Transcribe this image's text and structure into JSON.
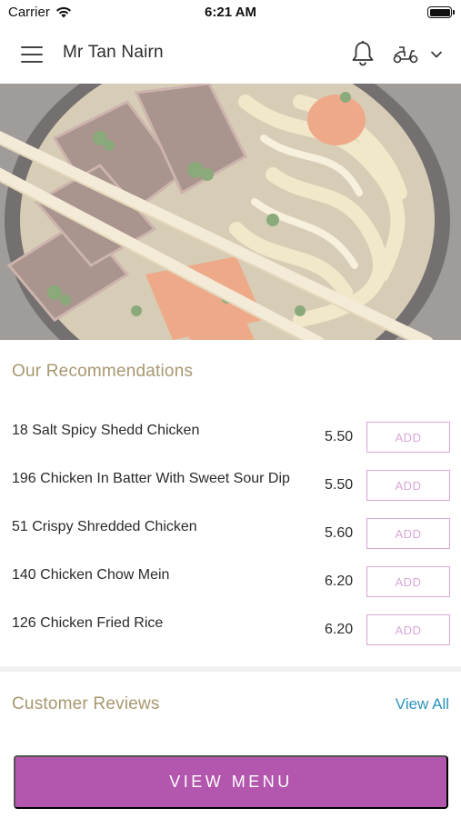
{
  "status_bar": {
    "carrier": "Carrier",
    "time": "6:21 AM"
  },
  "header": {
    "title": "Mr Tan Nairn",
    "icons": [
      "menu-icon",
      "bell-icon",
      "scooter-icon",
      "chevron-down-icon"
    ]
  },
  "recommendations": {
    "title": "Our Recommendations",
    "items": [
      {
        "name": "18 Salt Spicy Shedd Chicken",
        "price": "5.50",
        "button": "ADD"
      },
      {
        "name": "196 Chicken In Batter With Sweet Sour Dip",
        "price": "5.50",
        "button": "ADD"
      },
      {
        "name": "51 Crispy Shredded Chicken",
        "price": "5.60",
        "button": "ADD"
      },
      {
        "name": "140 Chicken Chow Mein",
        "price": "6.20",
        "button": "ADD"
      },
      {
        "name": "126 Chicken Fried Rice",
        "price": "6.20",
        "button": "ADD"
      }
    ]
  },
  "reviews": {
    "title": "Customer Reviews",
    "view_all": "View All"
  },
  "footer": {
    "view_menu_label": "VIEW MENU"
  },
  "colors": {
    "accent": "#b356ae",
    "add_button": "#d9a8d6",
    "section_title": "#a89870",
    "link": "#2a94b8"
  }
}
